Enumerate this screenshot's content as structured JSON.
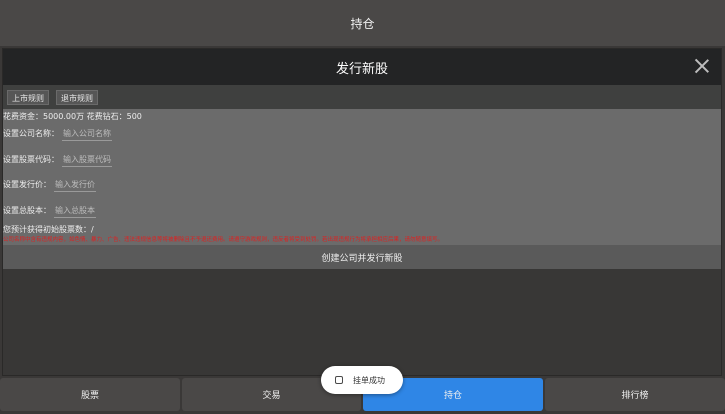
{
  "header": {
    "title": "持仓"
  },
  "dialog": {
    "title": "发行新股",
    "tabs": [
      "上市规则",
      "退市规则"
    ],
    "cost_text": "花费资金：5000.00万 花费钻石：500",
    "fields": [
      {
        "label": "设置公司名称：",
        "placeholder": "输入公司名称"
      },
      {
        "label": "设置股票代码：",
        "placeholder": "输入股票代码"
      },
      {
        "label": "设置发行价：",
        "placeholder": "输入发行价"
      },
      {
        "label": "设置总股本：",
        "placeholder": "输入总股本"
      }
    ],
    "estimate_text": "您预计获得初始股票数：/",
    "warning_text": "公司名称中含有违规内容，如色情、暴力、广告、违法违规信息等将被删除且不予退还费用。请遵守游戏规则，违反者将受到处罚。若出现违规行为将承担相应后果，请勿随意填写。",
    "create_button": "创建公司并发行新股"
  },
  "nav": {
    "items": [
      "股票",
      "交易",
      "持仓",
      "排行榜"
    ],
    "active": "持仓"
  },
  "toast": {
    "text": "挂单成功"
  }
}
